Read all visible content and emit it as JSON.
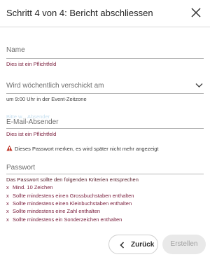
{
  "header": {
    "title": "Schritt 4 von 4: Bericht abschliessen",
    "close_icon": "close-icon"
  },
  "form": {
    "name": {
      "label": "Name",
      "error": "Dies ist ein Pflichtfeld"
    },
    "schedule": {
      "label": "Wird wöchentlich verschickt am",
      "hint": "um 9:00 Uhr in der Event-Zeitzone",
      "dropdown_icon": "chevron-down-icon"
    },
    "email_sender": {
      "faint_text": "Bitte w... Absender",
      "label": "E-Mail-Absender",
      "error": "Dies ist ein Pflichtfeld",
      "warning": "Dieses Passwort merken, es wird später nicht mehr angezeigt",
      "warning_icon": "warning-icon",
      "warning_color": "#c0392b"
    },
    "password": {
      "label": "Passwort",
      "criteria_heading": "Das Passwort sollte den folgenden Kriterien entsprechen",
      "criteria": [
        {
          "mark": "x",
          "text": "Mind. 10 Zeichen"
        },
        {
          "mark": "x",
          "text": "Sollte mindestens einen Grossbuchstaben enthalten"
        },
        {
          "mark": "x",
          "text": "Sollte mindestens einen Kleinbuchstaben enthalten"
        },
        {
          "mark": "x",
          "text": "Sollte mindestens eine Zahl enthalten"
        },
        {
          "mark": "x",
          "text": "Sollte mindestens ein Sonderzeichen enthalten"
        }
      ]
    }
  },
  "footer": {
    "back_label": "Zurück",
    "back_icon": "chevron-left-icon",
    "create_label": "Erstellen"
  },
  "colors": {
    "error": "#7a1f3d",
    "disabled_button": "#e9e9e9"
  }
}
